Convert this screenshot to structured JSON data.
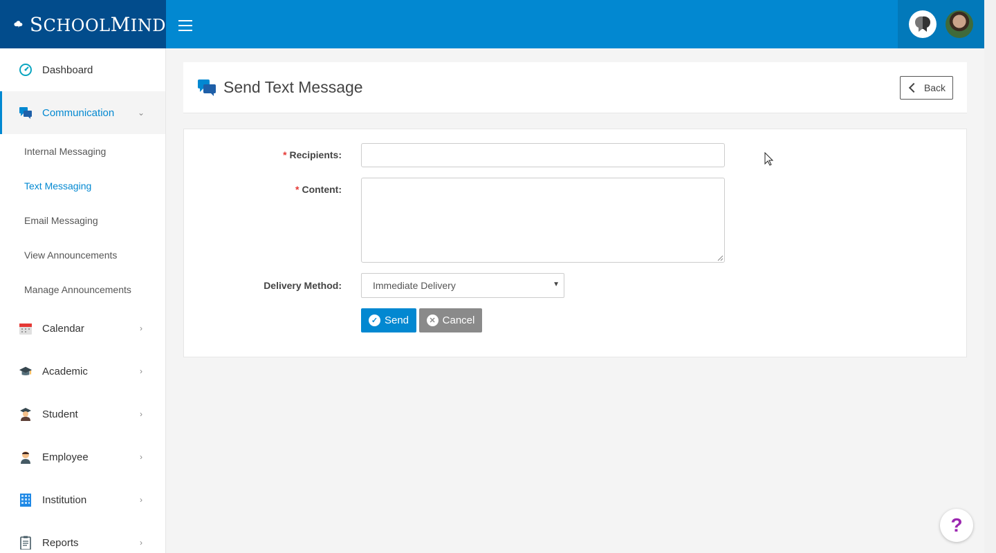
{
  "brand": {
    "name_first": "S",
    "name_rest": "CHOOL",
    "name_second": "M",
    "name_second_rest": "IND"
  },
  "sidebar": {
    "items": [
      {
        "label": "Dashboard",
        "icon": "dashboard-icon"
      },
      {
        "label": "Communication",
        "icon": "chat-bubbles-icon",
        "expanded": true
      },
      {
        "label": "Calendar",
        "icon": "calendar-icon"
      },
      {
        "label": "Academic",
        "icon": "graduation-cap-icon"
      },
      {
        "label": "Student",
        "icon": "student-icon"
      },
      {
        "label": "Employee",
        "icon": "employee-icon"
      },
      {
        "label": "Institution",
        "icon": "building-icon"
      },
      {
        "label": "Reports",
        "icon": "clipboard-icon"
      }
    ],
    "communication_sub": [
      {
        "label": "Internal Messaging"
      },
      {
        "label": "Text Messaging",
        "current": true
      },
      {
        "label": "Email Messaging"
      },
      {
        "label": "View Announcements"
      },
      {
        "label": "Manage Announcements"
      }
    ]
  },
  "page": {
    "title": "Send Text Message",
    "back_label": "Back"
  },
  "form": {
    "recipients_label": "Recipients:",
    "recipients_value": "",
    "content_label": "Content:",
    "content_value": "",
    "delivery_label": "Delivery Method:",
    "delivery_value": "Immediate Delivery",
    "send_label": "Send",
    "cancel_label": "Cancel"
  },
  "help": {
    "label": "?"
  },
  "colors": {
    "primary": "#0288d1",
    "header_dark": "#024c8c",
    "required": "#e53935",
    "help": "#9c27b0"
  }
}
